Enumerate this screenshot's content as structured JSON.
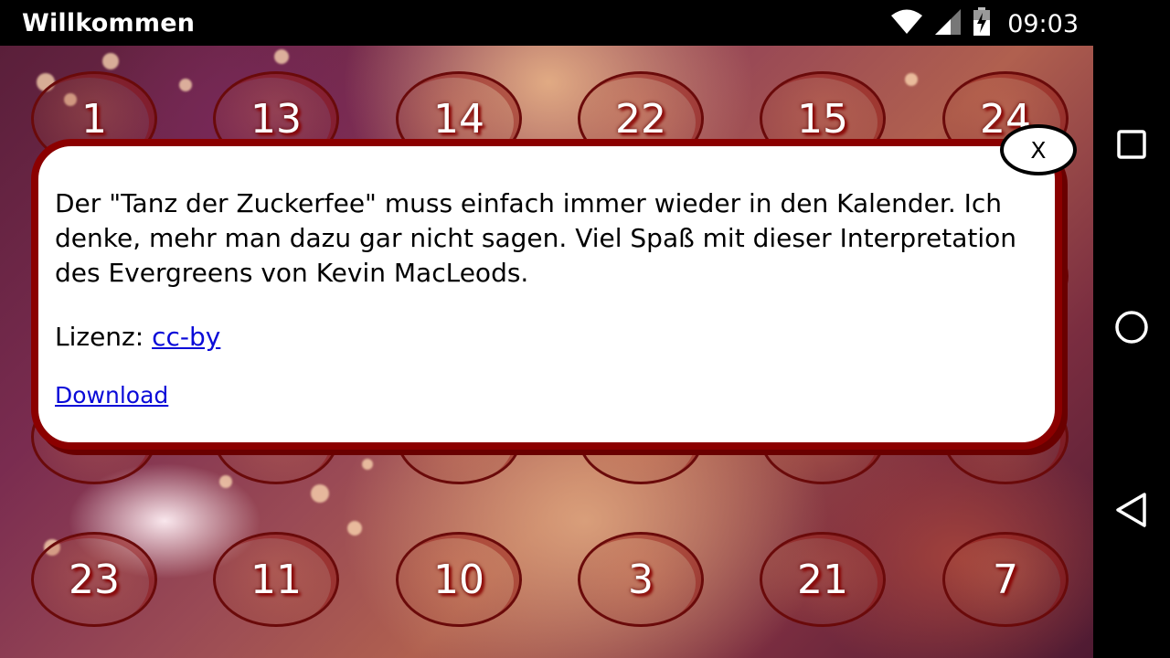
{
  "status_bar": {
    "title": "Willkommen",
    "time": "09:03",
    "icons": [
      "wifi-icon",
      "signal-icon",
      "battery-charging-icon"
    ]
  },
  "nav_bar": {
    "icons": [
      "recents-square-icon",
      "home-circle-icon",
      "back-triangle-icon"
    ]
  },
  "calendar": {
    "top_row": [
      "1",
      "13",
      "14",
      "22",
      "15",
      "24"
    ],
    "bottom_row": [
      "23",
      "11",
      "10",
      "3",
      "21",
      "7"
    ]
  },
  "dialog": {
    "close_label": "X",
    "description": "Der \"Tanz der Zuckerfee\" muss einfach immer wieder in den Kalender. Ich denke, mehr man dazu gar nicht sagen. Viel Spaß mit dieser Interpretation des Evergreens von Kevin MacLeods.",
    "license_label": "Lizenz:",
    "license_link": "cc-by",
    "download_link": "Download"
  },
  "colors": {
    "dialog_border": "#8b0000",
    "link": "#0a0ad8",
    "circle_border": "#6a0a0a"
  }
}
